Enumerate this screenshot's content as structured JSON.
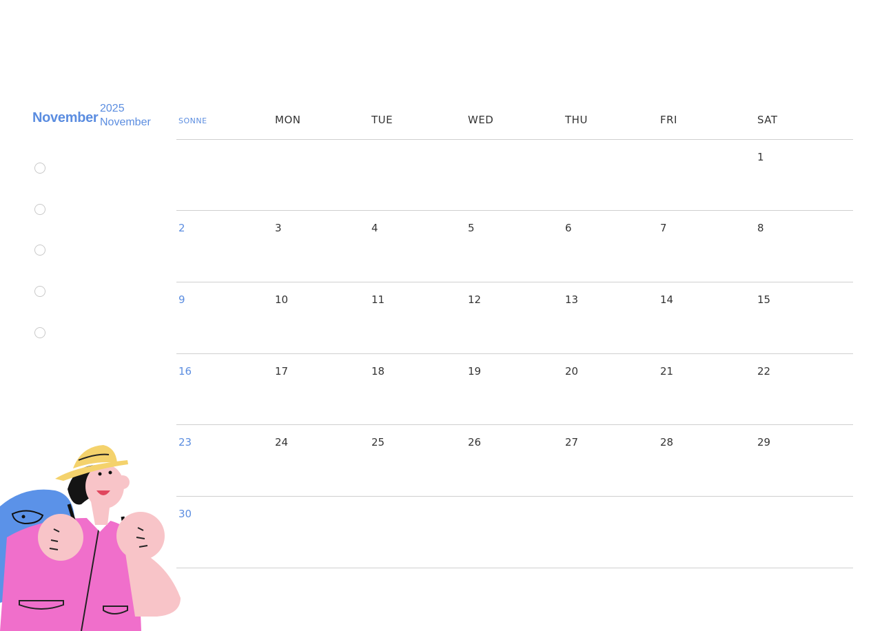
{
  "header": {
    "month": "November",
    "year": "2025",
    "month_secondary": "November"
  },
  "weekdays": [
    "SONNE",
    "MON",
    "TUE",
    "WED",
    "THU",
    "FRI",
    "SAT"
  ],
  "weeks": [
    [
      "",
      "",
      "",
      "",
      "",
      "",
      "1"
    ],
    [
      "2",
      "3",
      "4",
      "5",
      "6",
      "7",
      "8"
    ],
    [
      "9",
      "10",
      "11",
      "12",
      "13",
      "14",
      "15"
    ],
    [
      "16",
      "17",
      "18",
      "19",
      "20",
      "21",
      "22"
    ],
    [
      "23",
      "24",
      "25",
      "26",
      "27",
      "28",
      "29"
    ],
    [
      "30",
      "",
      "",
      "",
      "",
      "",
      ""
    ]
  ],
  "checklist_count": 5,
  "colors": {
    "accent": "#5b8de0",
    "text": "#333333",
    "grid": "#cfcfcf"
  },
  "illustration": "person-with-backpack-illustration"
}
